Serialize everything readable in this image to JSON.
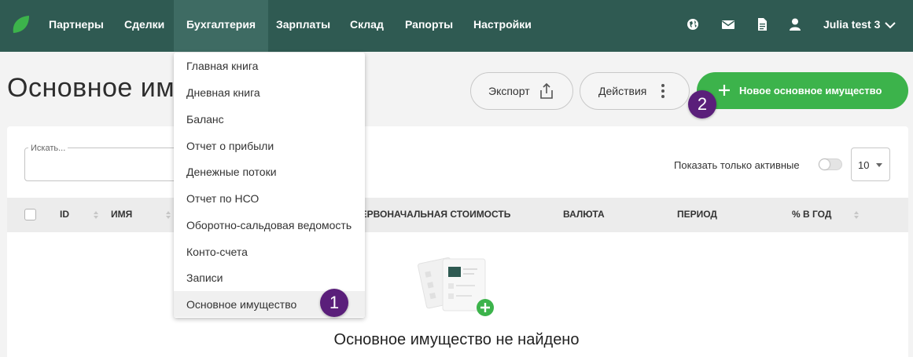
{
  "nav": {
    "items": [
      {
        "label": "Партнеры"
      },
      {
        "label": "Сделки"
      },
      {
        "label": "Бухгалтерия"
      },
      {
        "label": "Зарплаты"
      },
      {
        "label": "Склад"
      },
      {
        "label": "Рапорты"
      },
      {
        "label": "Настройки"
      }
    ],
    "active_index": 2,
    "user_name": "Julia test 3",
    "icons": [
      "globe-icon",
      "mail-icon",
      "document-icon",
      "user-icon",
      "chevron-down-icon"
    ]
  },
  "page": {
    "title": "Основное имущество",
    "export_label": "Экспорт",
    "actions_label": "Действия",
    "new_label": "Новое основное имущество"
  },
  "filters": {
    "search_label": "Искать...",
    "only_active_label": "Показать только активные",
    "page_size": "10"
  },
  "table": {
    "columns": [
      "ID",
      "ИМЯ",
      "ПЕРВОНАЧАЛЬНАЯ СТОИМОСТЬ",
      "ВАЛЮТА",
      "ПЕРИОД",
      "% В ГОД"
    ]
  },
  "empty": {
    "message": "Основное имущество не найдено"
  },
  "dropdown": {
    "items": [
      "Главная книга",
      "Дневная книга",
      "Баланс",
      "Отчет о прибыли",
      "Денежные потоки",
      "Отчет по НСО",
      "Оборотно-сальдовая ведомость",
      "Конто-счета",
      "Записи",
      "Основное имущество"
    ],
    "highlighted_index": 9
  },
  "annotations": {
    "badge1": "1",
    "badge2": "2"
  },
  "colors": {
    "nav_bg": "#2f5a52",
    "primary": "#3cb34b",
    "badge": "#5a1f7a"
  }
}
